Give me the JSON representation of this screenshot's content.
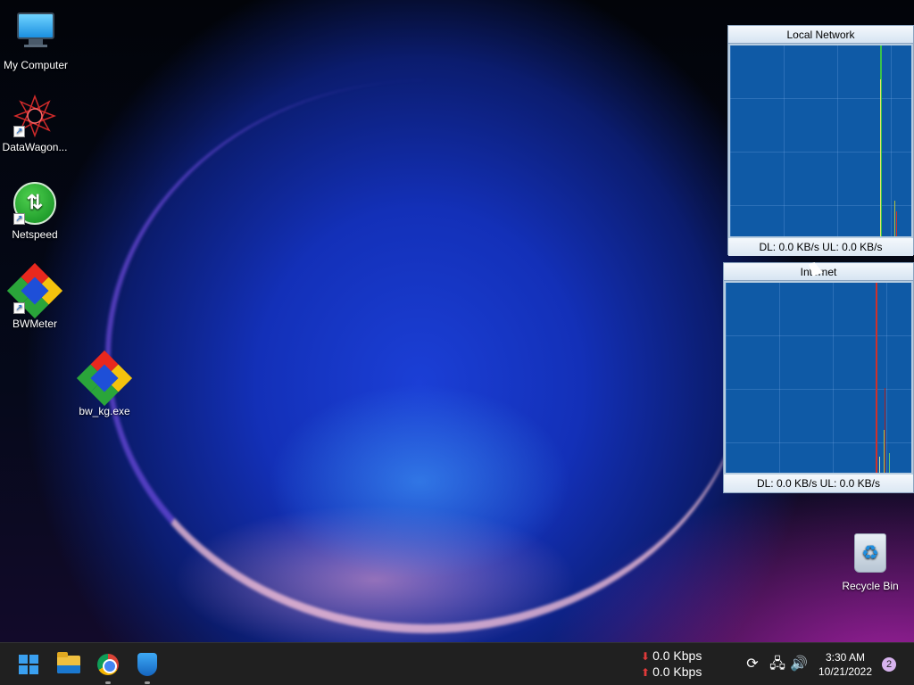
{
  "desktop": {
    "icons": [
      {
        "label": "My Computer",
        "icon": "monitor-icon"
      },
      {
        "label": "DataWagon...",
        "icon": "datawagon-icon"
      },
      {
        "label": "Netspeed",
        "icon": "netspeed-icon"
      },
      {
        "label": "BWMeter",
        "icon": "bwmeter-icon"
      },
      {
        "label": "bw_kg.exe",
        "icon": "bwmeter-icon"
      },
      {
        "label": "Recycle Bin",
        "icon": "recycle-bin-icon"
      }
    ]
  },
  "widgets": {
    "local": {
      "title": "Local Network",
      "status": "DL: 0.0 KB/s   UL: 0.0 KB/s"
    },
    "internet": {
      "title": "Internet",
      "status": "DL: 0.0 KB/s   UL: 0.0 KB/s"
    }
  },
  "taskbar": {
    "apps": [
      "start-icon",
      "file-explorer-icon",
      "chrome-icon",
      "windows-security-icon"
    ],
    "download_speed": "0.0 Kbps",
    "upload_speed": "0.0 Kbps",
    "time": "3:30 AM",
    "date": "10/21/2022",
    "notification_count": "2"
  },
  "colors": {
    "graph_bg": "#0f5aa6",
    "download_trace": "#39c24b",
    "upload_trace": "#d0302a",
    "accent": "#3aa0f0"
  }
}
